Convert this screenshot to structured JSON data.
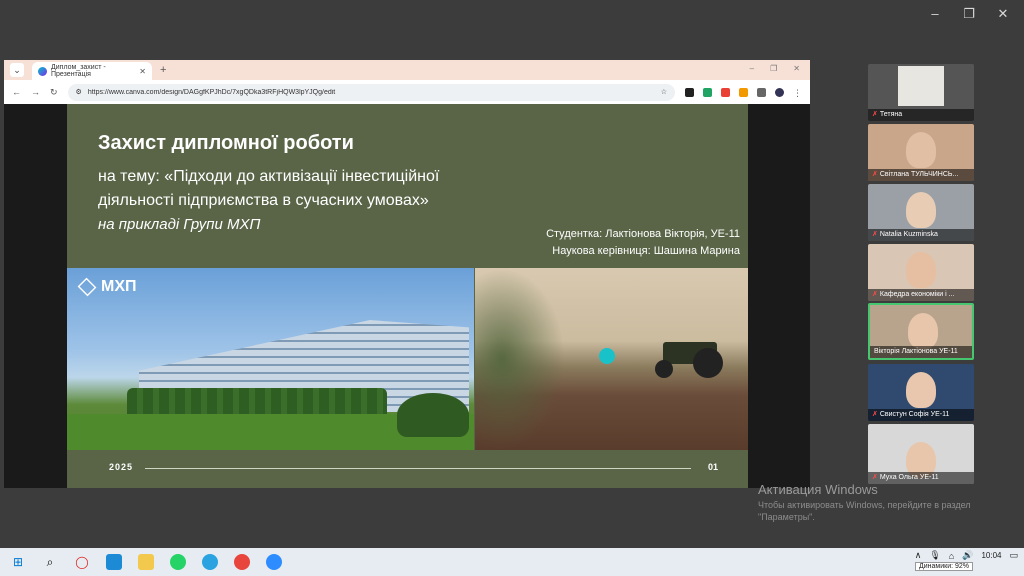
{
  "window_controls": [
    "–",
    "❐",
    "✕"
  ],
  "browser": {
    "tab_title": "Диплом_захист - Презентація",
    "new_tab": "+",
    "url": "https://www.canva.com/design/DAGgfKPJhDc/7xgQDka3tRFjHQW3lpYJQg/edit",
    "controls": [
      "–",
      "❐",
      "✕"
    ]
  },
  "slide": {
    "title": "Захист дипломної роботи",
    "subtitle_line1": "на тему: «Підходи до активізації інвестиційної",
    "subtitle_line2": "діяльності підприємства в сучасних умовах»",
    "subtitle_line3": "на прикладі Групи МХП",
    "student": "Студентка: Лактіонова Вікторія, УЕ-11",
    "advisor": "Наукова керівниця: Шашина Марина",
    "logo_text": "МХП",
    "year": "2025",
    "page": "01"
  },
  "participants": [
    {
      "name": "Тетяна",
      "active": false
    },
    {
      "name": "Світлана ТУЛЬЧИНСЬ...",
      "active": false
    },
    {
      "name": "Natalia Kuzminska",
      "active": false
    },
    {
      "name": "Кафедра економіки і ...",
      "active": false
    },
    {
      "name": "Вікторія Лактіонова УЕ-11",
      "active": true
    },
    {
      "name": "Свистун Софія УЕ-11",
      "active": false
    },
    {
      "name": "Муха Ольга УЕ-11",
      "active": false
    }
  ],
  "activation": {
    "title": "Активация Windows",
    "text": "Чтобы активировать Windows, перейдите в раздел \"Параметры\"."
  },
  "taskbar": {
    "time": "10:04",
    "tooltip": "Динамики: 92%"
  }
}
